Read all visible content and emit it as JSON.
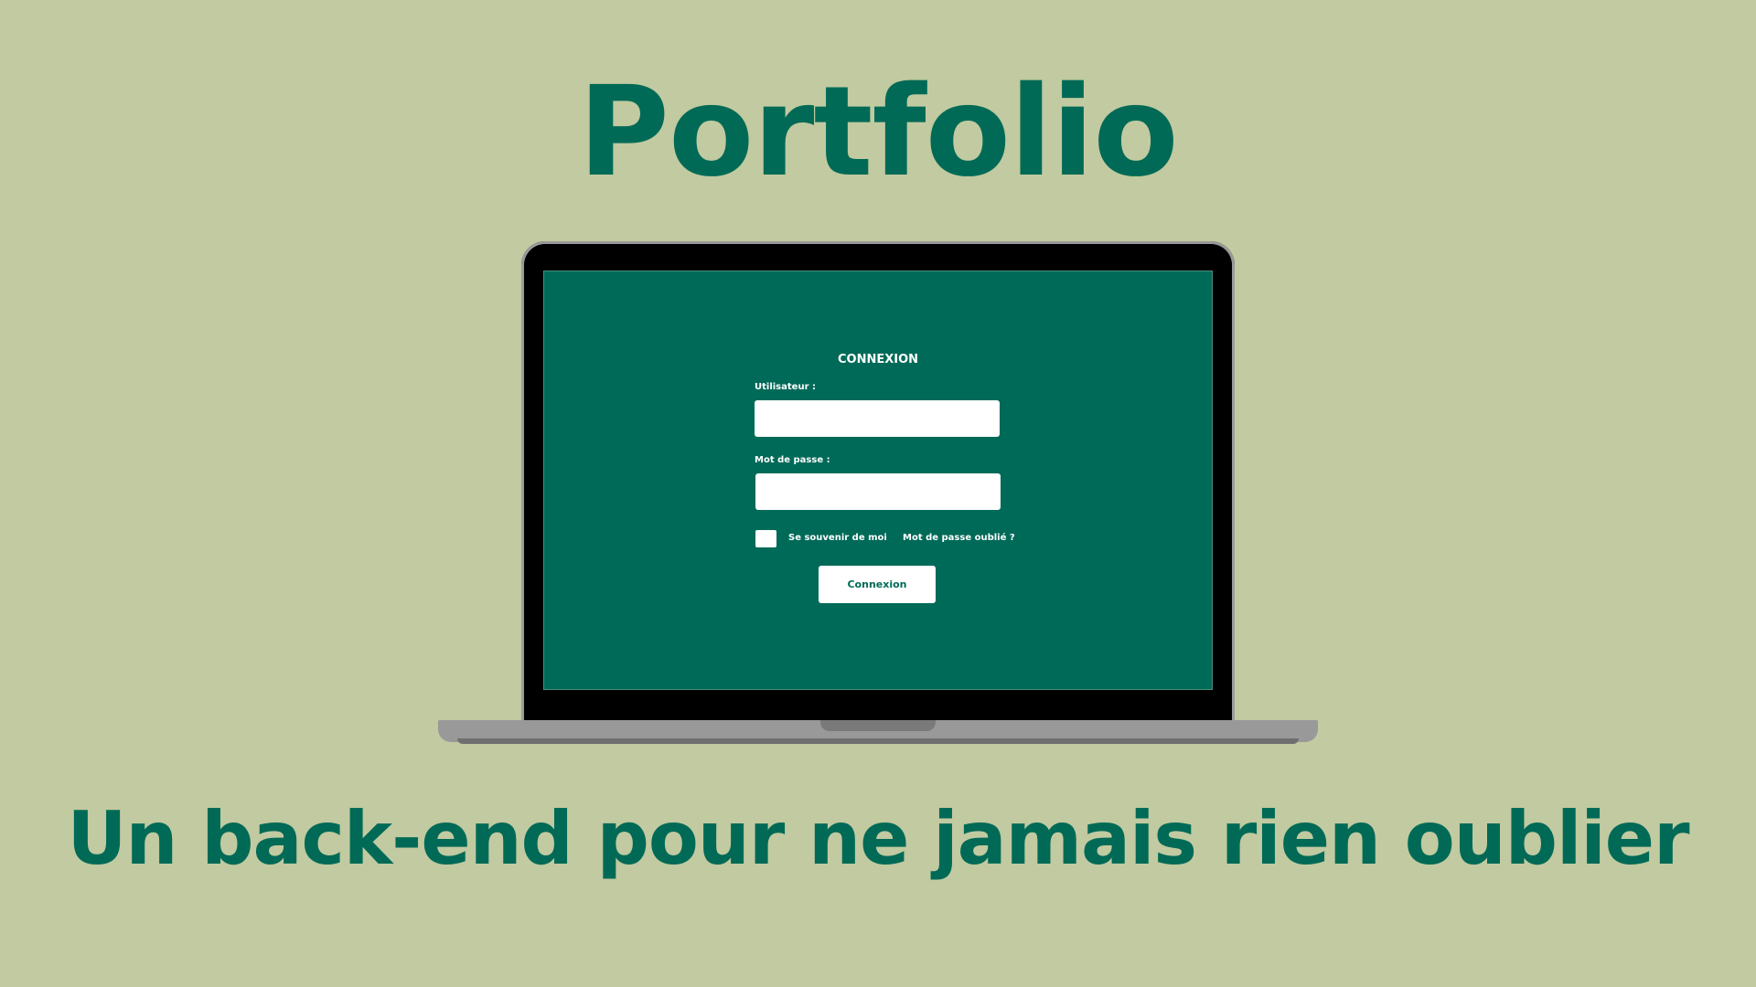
{
  "colors": {
    "background": "#c1caa0",
    "brand_green": "#006a56",
    "screen_green": "#006a58",
    "white": "#ffffff",
    "bezel": "#000000",
    "laptop_gray": "#999999"
  },
  "hero": {
    "title": "Portfolio",
    "subtitle": "Un back-end pour ne jamais rien oublier"
  },
  "login": {
    "heading": "CONNEXION",
    "username_label": "Utilisateur :",
    "username_value": "",
    "password_label": "Mot de passe :",
    "password_value": "",
    "remember_label": "Se souvenir de moi",
    "remember_checked": false,
    "forgot_label": "Mot de passe oublié ?",
    "submit_label": "Connexion"
  }
}
